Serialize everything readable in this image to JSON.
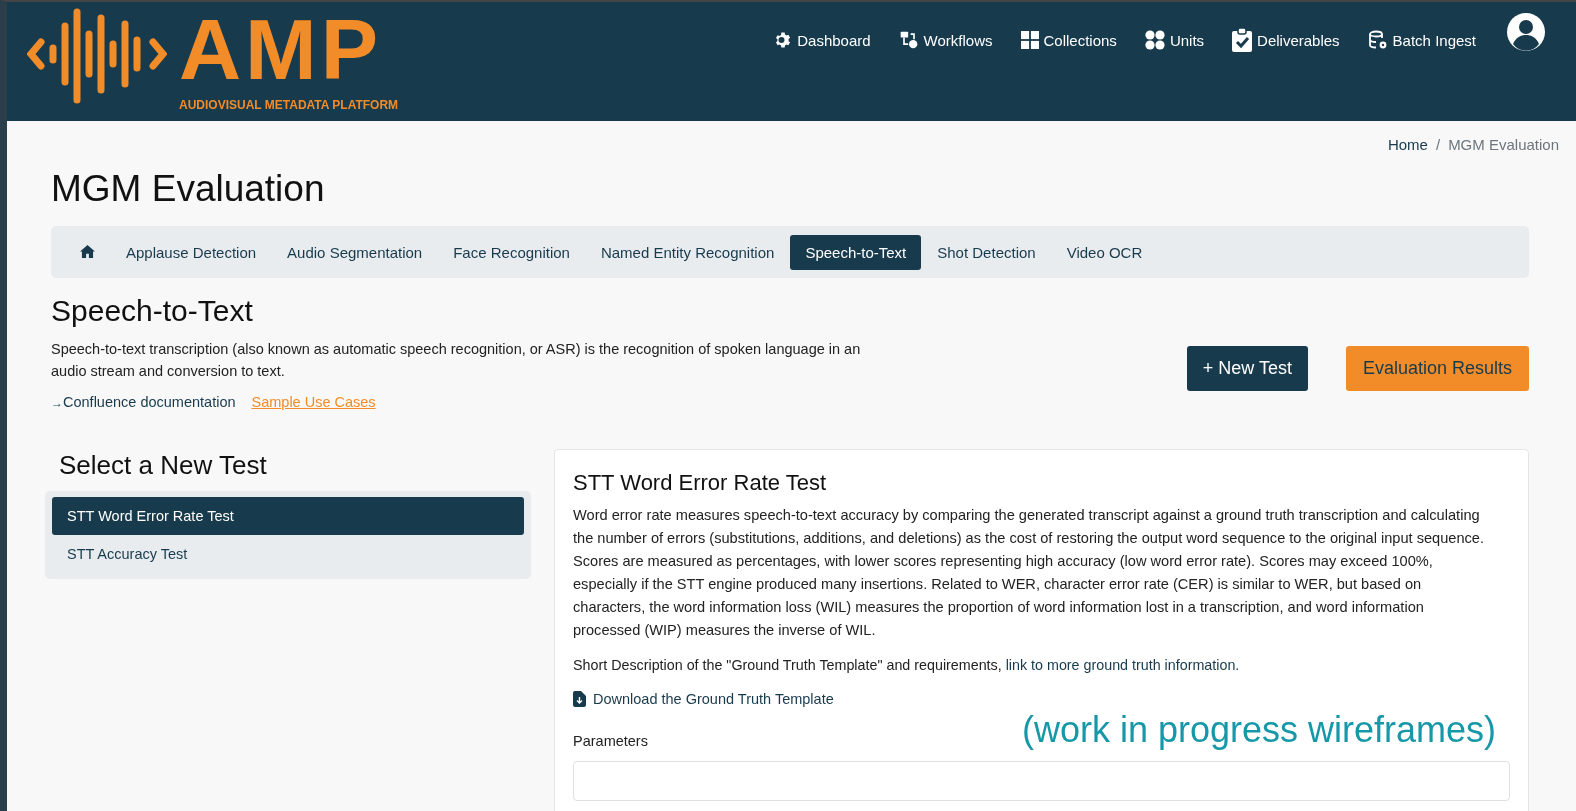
{
  "header": {
    "logo": {
      "wordmark": "AMP",
      "tagline": "AUDIOVISUAL METADATA PLATFORM"
    },
    "nav": [
      {
        "kind": "gear",
        "label": "Dashboard"
      },
      {
        "kind": "workflow",
        "label": "Workflows"
      },
      {
        "kind": "grid",
        "label": "Collections"
      },
      {
        "kind": "circles",
        "label": "Units"
      },
      {
        "kind": "clipboard",
        "label": "Deliverables"
      },
      {
        "kind": "database",
        "label": "Batch Ingest"
      }
    ]
  },
  "breadcrumb": [
    {
      "label": "Home",
      "selected": false
    },
    {
      "separator": "/",
      "label": "MGM Evaluation",
      "selected": true
    }
  ],
  "page_title": "MGM Evaluation",
  "tabs": [
    {
      "kind": "home",
      "selected": false
    },
    {
      "kind": "text",
      "label": "Applause Detection",
      "selected": false
    },
    {
      "kind": "text",
      "label": "Audio Segmentation",
      "selected": false
    },
    {
      "kind": "text",
      "label": "Face Recognition",
      "selected": false
    },
    {
      "kind": "text",
      "label": "Named Entity Recognition",
      "selected": false
    },
    {
      "kind": "text",
      "label": "Speech-to-Text",
      "selected": true
    },
    {
      "kind": "text",
      "label": "Shot Detection",
      "selected": false
    },
    {
      "kind": "text",
      "label": "Video OCR",
      "selected": false
    }
  ],
  "section": {
    "title": "Speech-to-Text",
    "description": "Speech-to-text transcription (also known as automatic speech recognition, or ASR) is the recognition of spoken language in an audio stream and conversion to text.",
    "links": [
      {
        "arrow": "→",
        "label": "Confluence documentation"
      },
      {
        "label": "Sample Use Cases"
      }
    ],
    "buttons": [
      {
        "kind": "primary",
        "label": "+ New Test"
      },
      {
        "kind": "accent",
        "label": "Evaluation Results"
      }
    ]
  },
  "test_picker": {
    "title": "Select a New Test",
    "items": [
      {
        "label": "STT Word Error Rate Test",
        "selected": true
      },
      {
        "label": "STT Accuracy Test",
        "selected": false
      }
    ]
  },
  "test_detail": {
    "title": "STT Word Error Rate Test",
    "description": "Word error rate measures speech-to-text accuracy by comparing the generated transcript against a ground truth transcription and calculating the number of errors (substitutions, additions, and deletions) as the cost of restoring the output word sequence to the original input sequence. Scores are measured as percentages, with lower scores representing high accuracy (low word error rate). Scores may exceed 100%, especially if the STT engine produced many insertions. Related to WER, character error rate (CER) is similar to WER, but based on characters, the word information loss (WIL) measures the proportion of word information lost in a transcription, and word information processed (WIP) measures the inverse of WIL.",
    "ground_truth_note": "Short Description of the \"Ground Truth Template\" and requirements, ",
    "ground_truth_link": "link to more ground truth information.",
    "download_link": "Download the Ground Truth Template",
    "parameters_label": "Parameters"
  },
  "annotation": "(work in progress wireframes)"
}
